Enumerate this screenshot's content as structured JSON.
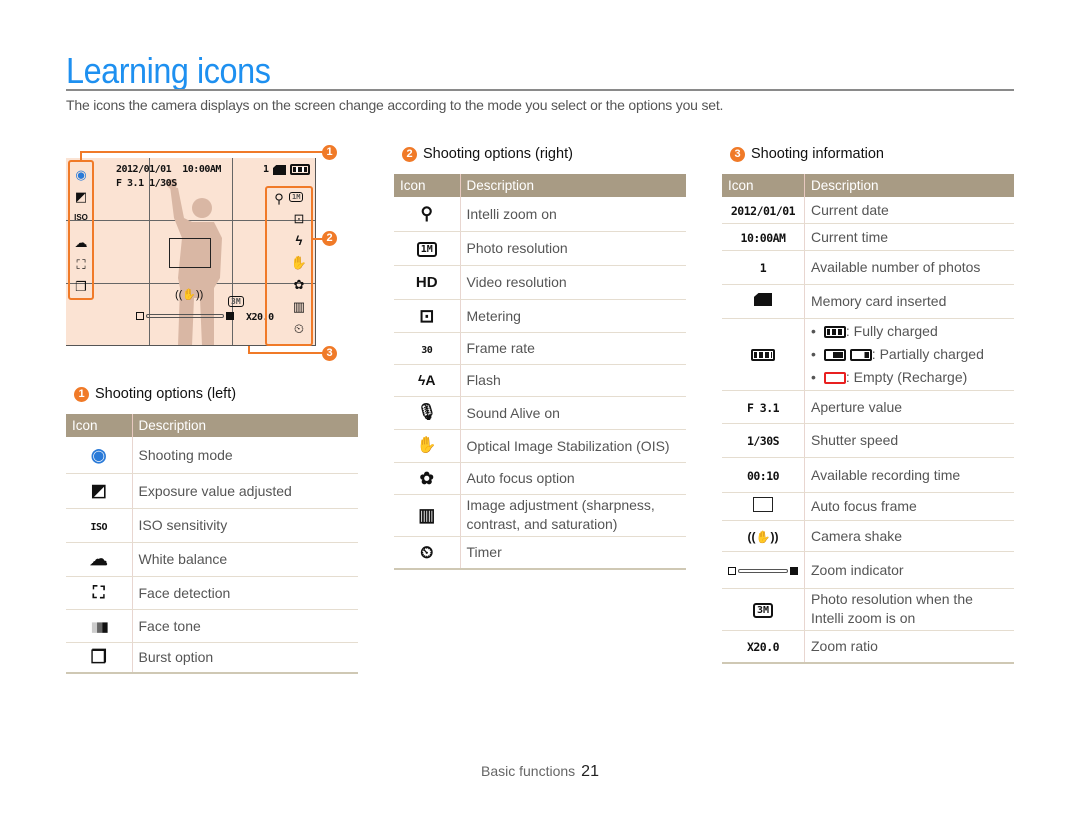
{
  "page": {
    "title": "Learning icons",
    "intro": "The icons the camera displays on the screen change according to the mode you select or the options you set."
  },
  "screen_preview": {
    "date": "2012/01/01",
    "time": "10:00AM",
    "aperture_shutter": "F 3.1 1/30S",
    "photos_count": "1",
    "zoom_ratio": "X20.0",
    "resolution": "3M",
    "callouts": [
      "1",
      "2",
      "3"
    ]
  },
  "accent_colors": {
    "title": "#1e90f0",
    "callout": "#f07a28",
    "table_header": "#a89b84",
    "screen_bg": "#fbe3d3",
    "battery_empty": "#e82020"
  },
  "sections": {
    "left": {
      "number": "1",
      "title": "Shooting options (left)",
      "headers": [
        "Icon",
        "Description"
      ],
      "rows": [
        {
          "icon": "shooting-mode-icon",
          "glyph": "📷",
          "desc": "Shooting mode"
        },
        {
          "icon": "exposure-icon",
          "glyph": "◩",
          "desc": "Exposure value adjusted"
        },
        {
          "icon": "iso-icon",
          "glyph": "ISO",
          "desc": "ISO sensitivity"
        },
        {
          "icon": "white-balance-icon",
          "glyph": "☁",
          "desc": "White balance"
        },
        {
          "icon": "face-detection-icon",
          "glyph": "⛶",
          "desc": "Face detection"
        },
        {
          "icon": "face-tone-icon",
          "glyph": "▮▮▮",
          "desc": "Face tone"
        },
        {
          "icon": "burst-icon",
          "glyph": "❐",
          "desc": "Burst option"
        }
      ]
    },
    "right": {
      "number": "2",
      "title": "Shooting options (right)",
      "headers": [
        "Icon",
        "Description"
      ],
      "rows": [
        {
          "icon": "intelli-zoom-icon",
          "glyph": "🔍",
          "desc": "Intelli zoom on"
        },
        {
          "icon": "photo-resolution-icon",
          "glyph": "1M",
          "desc": "Photo resolution"
        },
        {
          "icon": "video-resolution-icon",
          "glyph": "HD",
          "desc": "Video resolution"
        },
        {
          "icon": "metering-icon",
          "glyph": "⊡",
          "desc": "Metering"
        },
        {
          "icon": "frame-rate-icon",
          "glyph": "30",
          "desc": "Frame rate"
        },
        {
          "icon": "flash-icon",
          "glyph": "ϟA",
          "desc": "Flash"
        },
        {
          "icon": "sound-alive-icon",
          "glyph": "🎙",
          "desc": "Sound Alive on"
        },
        {
          "icon": "ois-icon",
          "glyph": "✋",
          "desc": "Optical Image Stabilization (OIS)"
        },
        {
          "icon": "auto-focus-icon",
          "glyph": "✿",
          "desc": "Auto focus option"
        },
        {
          "icon": "image-adjust-icon",
          "glyph": "▥",
          "desc": "Image adjustment (sharpness, contrast, and saturation)"
        },
        {
          "icon": "timer-icon",
          "glyph": "⏲",
          "desc": "Timer"
        }
      ]
    },
    "info": {
      "number": "3",
      "title": "Shooting information",
      "headers": [
        "Icon",
        "Description"
      ],
      "rows": [
        {
          "icon": "date-text",
          "glyph": "2012/01/01",
          "desc": "Current date"
        },
        {
          "icon": "time-text",
          "glyph": "10:00AM",
          "desc": "Current time"
        },
        {
          "icon": "photo-count-text",
          "glyph": "1",
          "desc": "Available number of photos"
        },
        {
          "icon": "memory-card-icon",
          "glyph": "",
          "desc": "Memory card inserted"
        },
        {
          "icon": "battery-icon",
          "glyph": "",
          "desc": ""
        },
        {
          "icon": "aperture-text",
          "glyph": "F 3.1",
          "desc": "Aperture value"
        },
        {
          "icon": "shutter-text",
          "glyph": "1/30S",
          "desc": "Shutter speed"
        },
        {
          "icon": "recording-time-text",
          "glyph": "00:10",
          "desc": "Available recording time"
        },
        {
          "icon": "af-frame-icon",
          "glyph": "",
          "desc": "Auto focus frame"
        },
        {
          "icon": "camera-shake-icon",
          "glyph": "((✋))",
          "desc": "Camera shake"
        },
        {
          "icon": "zoom-indicator-icon",
          "glyph": "",
          "desc": "Zoom indicator"
        },
        {
          "icon": "intelli-resolution-icon",
          "glyph": "3M",
          "desc": "Photo resolution when the Intelli zoom is on"
        },
        {
          "icon": "zoom-ratio-text",
          "glyph": "X20.0",
          "desc": "Zoom ratio"
        }
      ],
      "battery_states": [
        {
          "label": ": Fully charged"
        },
        {
          "label": ": Partially charged"
        },
        {
          "label": ": Empty (Recharge)"
        }
      ]
    }
  },
  "footer": {
    "section": "Basic functions",
    "page_number": "21"
  }
}
